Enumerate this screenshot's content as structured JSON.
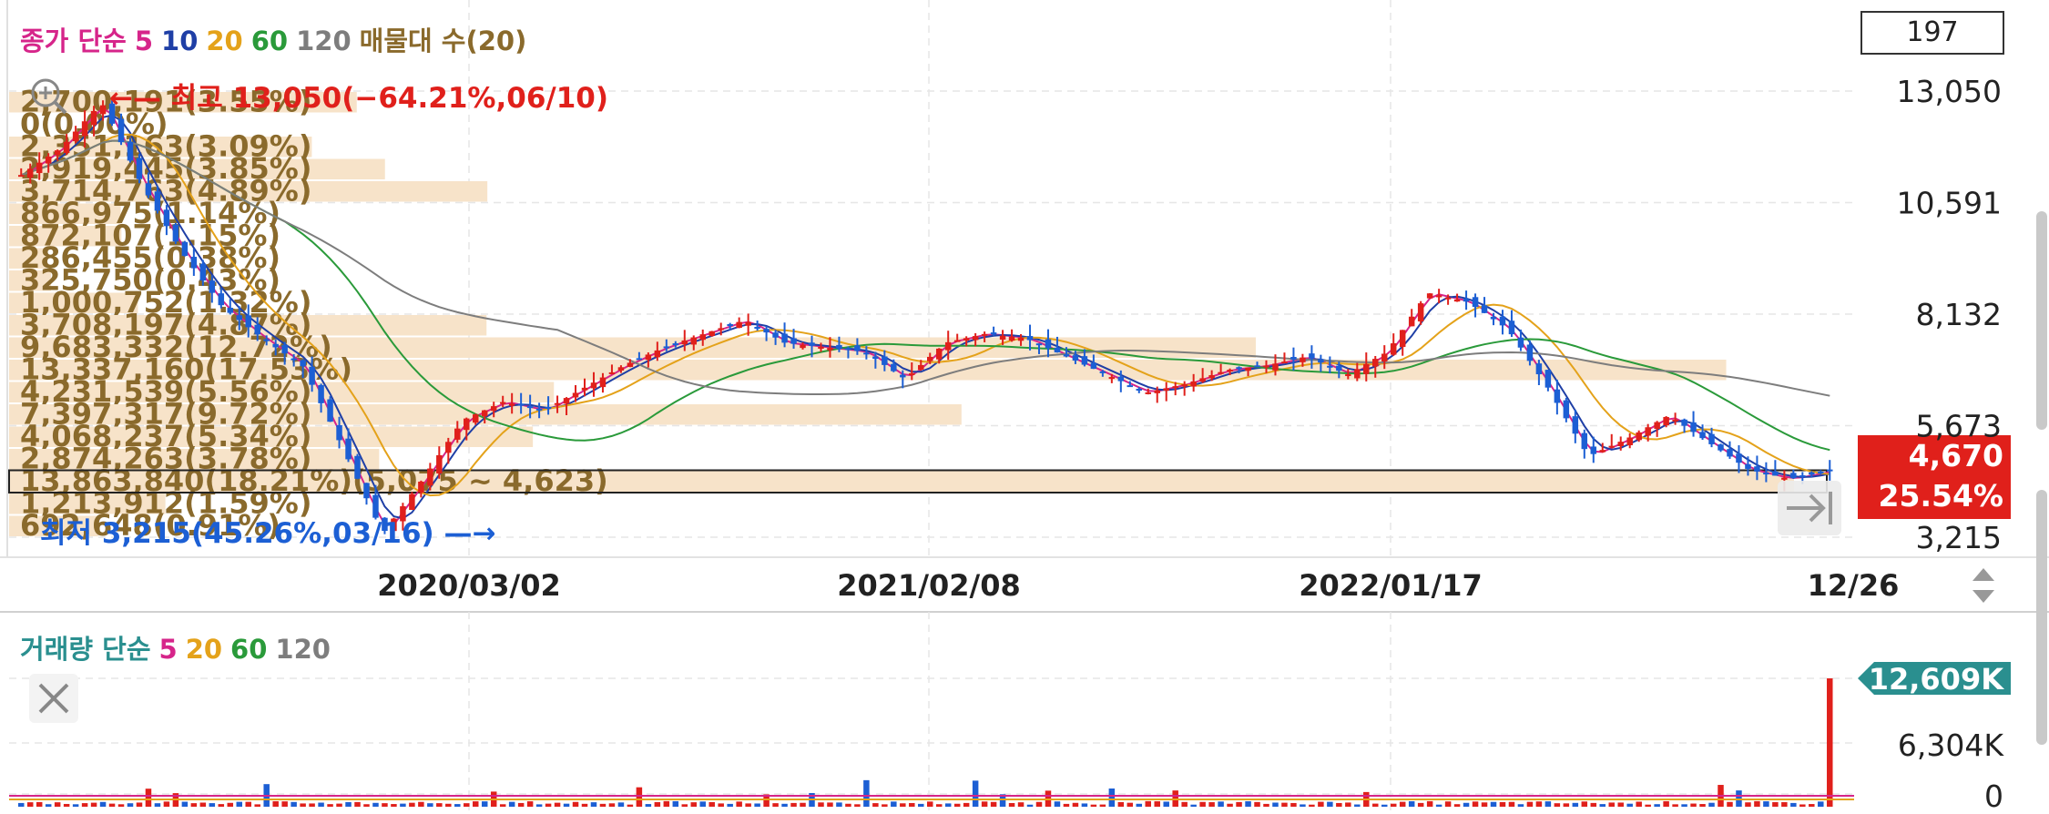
{
  "price_legend": {
    "items": [
      {
        "text": "종가 단순",
        "color": "#d6258a"
      },
      {
        "text": "5",
        "color": "#d6258a"
      },
      {
        "text": "10",
        "color": "#1f3fa6"
      },
      {
        "text": "20",
        "color": "#e4a21a"
      },
      {
        "text": "60",
        "color": "#2a9a3a"
      },
      {
        "text": "120",
        "color": "#7d7d7d"
      },
      {
        "text": "매물대 수(20)",
        "color": "#8a6a2c"
      }
    ]
  },
  "volume_legend": {
    "items": [
      {
        "text": "거래량 단순",
        "color": "#2a8f8f"
      },
      {
        "text": "5",
        "color": "#d6258a"
      },
      {
        "text": "20",
        "color": "#e4a21a"
      },
      {
        "text": "60",
        "color": "#2a9a3a"
      },
      {
        "text": "120",
        "color": "#7d7d7d"
      }
    ]
  },
  "count_box": "197",
  "icons": {
    "zoom": "zoom-in-icon",
    "close": "close-icon",
    "jump": "jump-to-latest-icon",
    "sort": "sort-arrows-icon"
  },
  "colors": {
    "up": "#e0201b",
    "down": "#1c5fd4",
    "ma5": "#d6258a",
    "ma10": "#1f3fa6",
    "ma20": "#e4a21a",
    "ma60": "#2a9a3a",
    "ma120": "#7d7d7d",
    "profile": "#f7e3c9",
    "profile_text": "#8a6a2c",
    "volume_badge": "#2a8f8f",
    "price_badge": "#e0201b"
  },
  "chart_data": [
    {
      "type": "candlestick",
      "title": "",
      "y_axis_labels": [
        "13,050",
        "10,591",
        "8,132",
        "5,673",
        "3,215"
      ],
      "ylim": [
        3215,
        13050
      ],
      "x_axis_labels": [
        "2020/03/02",
        "2021/02/08",
        "2022/01/17",
        "12/26"
      ],
      "high_annotation": "최고 13,050(−64.21%,06/10)",
      "low_annotation": "최저 3,215(45.26%,03/16)",
      "current_price": "4,670",
      "current_change": "25.54%",
      "volume_profile": [
        {
          "label": "2,700,191(3.55%)",
          "value": 2700191
        },
        {
          "label": "0(0.00%)",
          "value": 0
        },
        {
          "label": "2,351,163(3.09%)",
          "value": 2351163
        },
        {
          "label": "2,919,445(3.85%)",
          "value": 2919445
        },
        {
          "label": "3,714,763(4.89%)",
          "value": 3714763
        },
        {
          "label": "866,975(1.14%)",
          "value": 866975
        },
        {
          "label": "872,107(1.15%)",
          "value": 872107
        },
        {
          "label": "286,455(0.38%)",
          "value": 286455
        },
        {
          "label": "325,750(0.43%)",
          "value": 325750
        },
        {
          "label": "1,000,752(1.32%)",
          "value": 1000752
        },
        {
          "label": "3,708,197(4.87%)",
          "value": 3708197
        },
        {
          "label": "9,683,332(12.72%)",
          "value": 9683332
        },
        {
          "label": "13,337,160(17.53%)",
          "value": 13337160
        },
        {
          "label": "4,231,539(5.56%)",
          "value": 4231539
        },
        {
          "label": "7,397,317(9.72%)",
          "value": 7397317
        },
        {
          "label": "4,068,237(5.34%)",
          "value": 4068237
        },
        {
          "label": "2,874,263(3.78%)",
          "value": 2874263
        },
        {
          "label": "13,863,840(18.21%)(5,075 ~ 4,623)",
          "value": 13863840
        },
        {
          "label": "1,213,912(1.59%)",
          "value": 1213912
        },
        {
          "label": "692,648(0.91%)",
          "value": 692648
        }
      ],
      "series_close_approx": [
        11200,
        11800,
        12800,
        11000,
        9500,
        8300,
        7600,
        7000,
        5200,
        3300,
        4500,
        5800,
        6200,
        6000,
        6500,
        7000,
        7400,
        7700,
        8000,
        7500,
        7400,
        7300,
        6700,
        7500,
        7700,
        7600,
        7200,
        6800,
        6400,
        6600,
        6900,
        7000,
        7200,
        6800,
        7300,
        8600,
        8400,
        7800,
        6500,
        5000,
        5400,
        5900,
        5300,
        4700,
        4500,
        4670
      ]
    },
    {
      "type": "bar",
      "title": "",
      "y_axis_labels": [
        "12,609K",
        "6,304K",
        "0"
      ],
      "ylim": [
        0,
        12609
      ],
      "last_value_label": "12,609K"
    }
  ]
}
